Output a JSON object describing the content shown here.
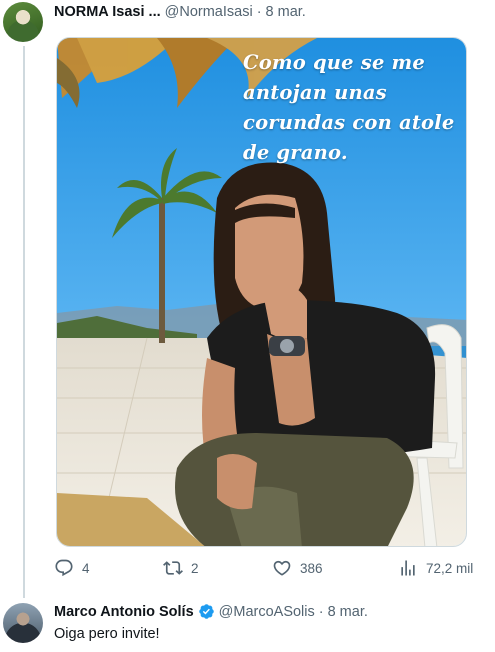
{
  "tweet": {
    "author_name": "NORMA Isasi ...",
    "author_handle": "@NormaIsasi",
    "separator": "·",
    "date": "8 mar.",
    "image_text": "Como que se me antojan unas corundas con atole de grano.",
    "actions": {
      "replies": "4",
      "retweets": "2",
      "likes": "386",
      "views": "72,2 mil"
    }
  },
  "reply": {
    "author_name": "Marco Antonio Solís",
    "author_handle": "@MarcoASolis",
    "separator": "·",
    "date": "8 mar.",
    "text": "Oiga pero invite!"
  },
  "colors": {
    "text_primary": "#0f1419",
    "text_secondary": "#536471",
    "verified_blue": "#1d9bf0",
    "thread_line": "#cfd9de"
  },
  "icons": [
    "reply-icon",
    "retweet-icon",
    "like-icon",
    "views-icon",
    "verified-badge-icon"
  ]
}
